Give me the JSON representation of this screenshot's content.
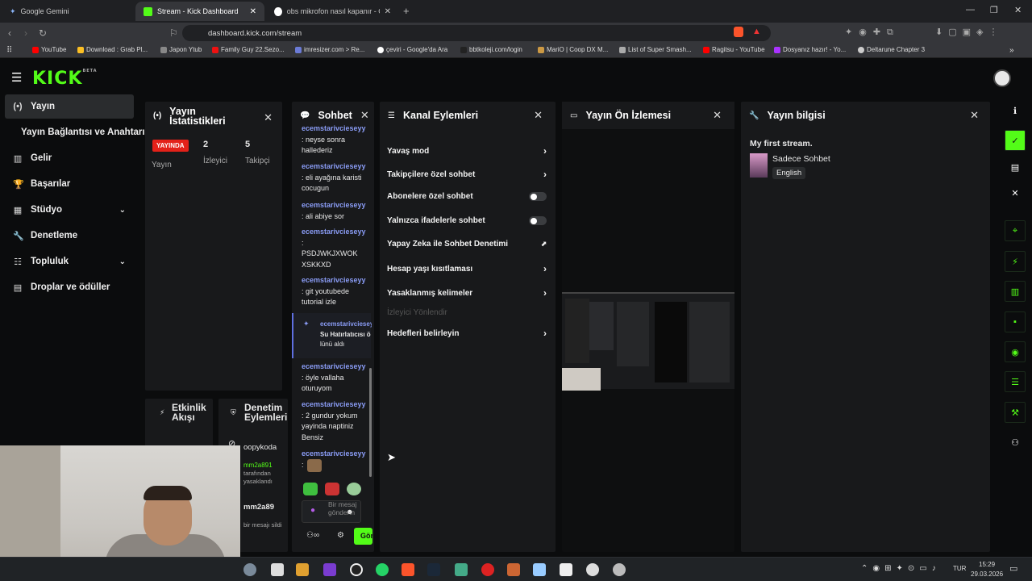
{
  "browser": {
    "tabs": [
      {
        "label": "Google Gemini"
      },
      {
        "label": "Stream - Kick Dashboard"
      },
      {
        "label": "obs mikrofon nasıl kapanır - Google'"
      }
    ],
    "url": "dashboard.kick.com/stream",
    "bookmarks": [
      "YouTube",
      "Download : Grab Pl...",
      "Japon Ytub",
      "Family Guy 22.Sezo...",
      "imresizer.com > Re...",
      "çeviri - Google'da Ara",
      "bbtkoleji.com/login",
      "MariO | Coop DX M...",
      "List of Super Smash...",
      "Ragitsu - YouTube",
      "Dosyanız hazır! - Yo...",
      "Deltarune Chapter 3"
    ]
  },
  "brand": {
    "logo": "KICK",
    "beta": "BETA",
    "accent": "#53fc18"
  },
  "sidebar": {
    "items": [
      {
        "label": "Yayın",
        "icon": "broadcast-icon"
      },
      {
        "label": "Yayın Bağlantısı ve Anahtarı"
      },
      {
        "label": "Gelir",
        "icon": "chart-icon"
      },
      {
        "label": "Başarılar",
        "icon": "trophy-icon"
      },
      {
        "label": "Stüdyo",
        "icon": "grid-icon"
      },
      {
        "label": "Denetleme",
        "icon": "wrench-icon"
      },
      {
        "label": "Topluluk",
        "icon": "community-icon"
      },
      {
        "label": "Droplar ve ödüller",
        "icon": "gift-icon"
      }
    ]
  },
  "stats": {
    "title": "Yayın İstatistikleri",
    "live_badge": "YAYINDA",
    "viewers": "2",
    "followers": "5",
    "label_stream": "Yayın",
    "label_viewers": "İzleyici",
    "label_followers": "Takipçi"
  },
  "activity": {
    "title": "Etkinlik Akışı"
  },
  "moderation": {
    "title": "Denetim Eylemleri",
    "entries": [
      {
        "user": "oopykoda"
      },
      {
        "user": "mm2a891",
        "text": "tarafından yasaklandı"
      },
      {
        "user": "mm2a89",
        "text": "bir mesajı sildi"
      }
    ]
  },
  "chat": {
    "title": "Sohbet",
    "messages": [
      {
        "user": "ecemstarivcieseyy",
        "text": ": neyse sonra hallederiz"
      },
      {
        "user": "ecemstarivcieseyy",
        "text": ": eli ayağına karisti cocugun"
      },
      {
        "user": "ecemstarivcieseyy",
        "text": ": ali abiye sor"
      },
      {
        "user": "ecemstarivcieseyy",
        "text": ": PSDJWKJXWOK XSKKXD"
      },
      {
        "user": "ecemstarivcieseyy",
        "text": ": git youtubede tutorial izle"
      },
      {
        "user": "ecemstarivcieseyy",
        "text": ": öyle vallaha oturuyom"
      },
      {
        "user": "ecemstarivcieseyy",
        "text": ": 2 gundur yokum yayinda naptiniz Bensiz"
      },
      {
        "user": "ecemstarivcieseyy",
        "text": ":"
      }
    ],
    "highlight": {
      "user": "ecemstarivcieseyy",
      "text": "Su Hatırlatıcısı ö",
      "text2": "lünü aldı"
    },
    "input_placeholder": "Bir mesaj gönderin",
    "send_label": "Gönder"
  },
  "channel_actions": {
    "title": "Kanal Eylemleri",
    "items": [
      {
        "label": "Yavaş mod"
      },
      {
        "label": "Takipçilere özel sohbet"
      },
      {
        "label": "Abonelere özel sohbet"
      },
      {
        "label": "Yalnızca ifadelerle sohbet"
      },
      {
        "label": "Yapay Zeka ile Sohbet Denetimi"
      },
      {
        "label": "Hesap yaşı kısıtlaması"
      },
      {
        "label": "Yasaklanmış kelimeler"
      },
      {
        "label": "İzleyici Yönlendir"
      },
      {
        "label": "Hedefleri belirleyin"
      }
    ]
  },
  "preview": {
    "title": "Yayın Ön İzlemesi"
  },
  "stream_info": {
    "title": "Yayın bilgisi",
    "stream_title": "My first stream.",
    "category": "Sadece Sohbet",
    "language": "English"
  },
  "taskbar": {
    "lang": "TUR",
    "time": "15:29",
    "date": "29.03.2026"
  }
}
